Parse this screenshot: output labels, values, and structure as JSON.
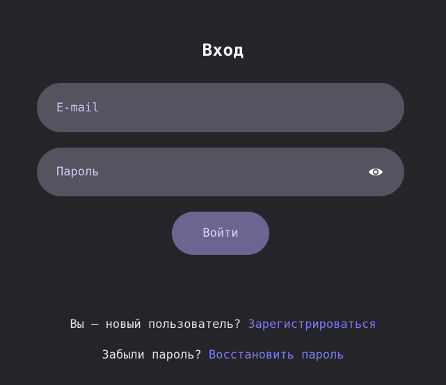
{
  "login": {
    "title": "Вход",
    "email_placeholder": "E-mail",
    "password_placeholder": "Пароль",
    "submit_label": "Войти",
    "show_password_icon": "eye-icon"
  },
  "footer": {
    "register_prompt": "Вы — новый пользователь?",
    "register_link": "Зарегистрироваться",
    "forgot_prompt": "Забыли пароль?",
    "restore_link": "Восстановить пароль"
  },
  "colors": {
    "background": "#252429",
    "field": "#54535f",
    "button": "#6a6591",
    "link": "#7f7bf6"
  }
}
